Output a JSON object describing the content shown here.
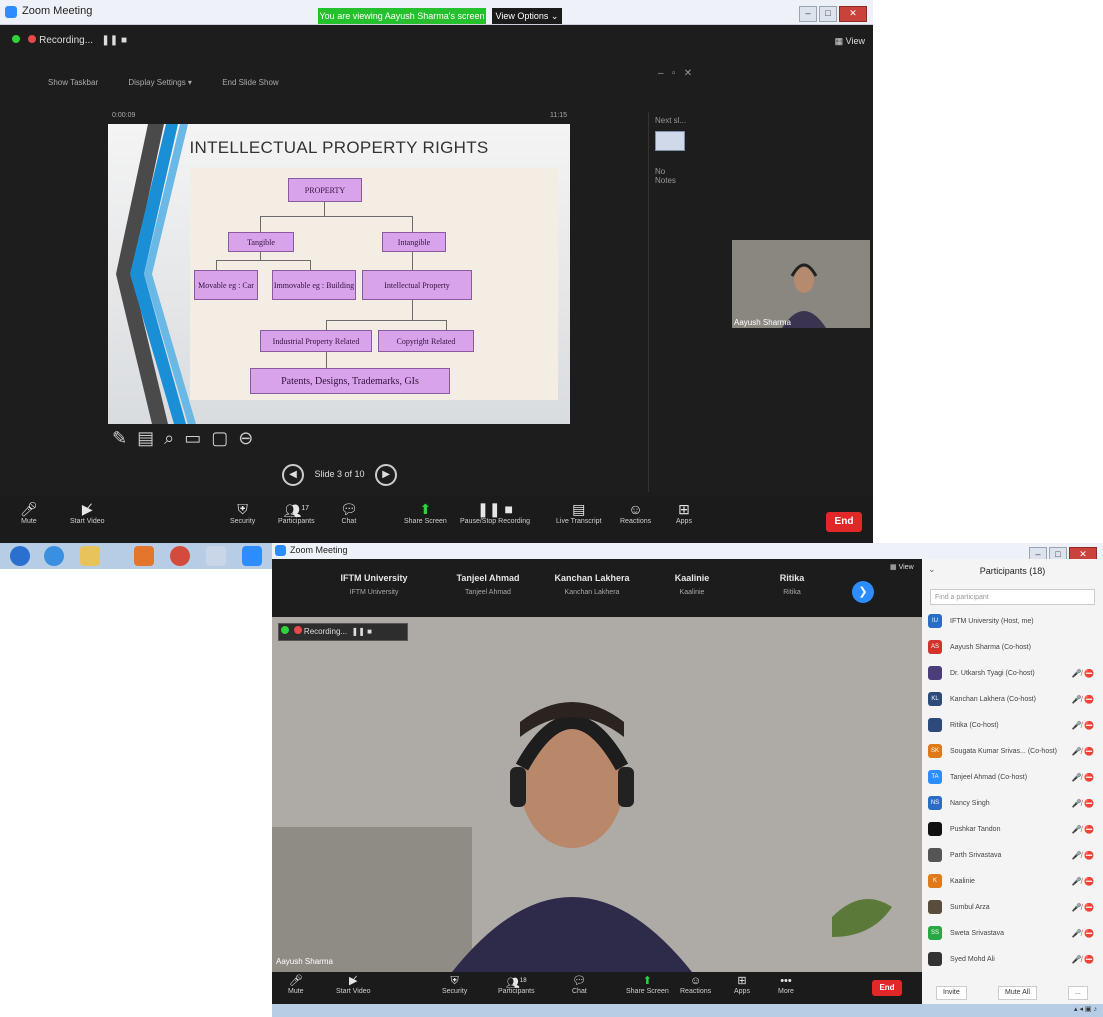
{
  "win1": {
    "title": "Zoom Meeting",
    "screen_share_banner": "You are viewing Aayush Sharma's screen",
    "view_options": "View Options ⌄",
    "view_btn": "View",
    "recording_label": "Recording...",
    "toolbar": [
      "Show Taskbar",
      "Display Settings ▾",
      "End Slide Show"
    ],
    "timer": "0:00:09",
    "clock": "11:15",
    "slide": {
      "title": "INTELLECTUAL PROPERTY RIGHTS",
      "boxes": {
        "property": "PROPERTY",
        "tangible": "Tangible",
        "intangible": "Intangible",
        "movable": "Movable eg : Car",
        "immovable": "Immovable eg : Building",
        "ip": "Intellectual Property",
        "industrial": "Industrial Property Related",
        "copyright": "Copyright Related",
        "patents": "Patents, Designs, Trademarks, GIs"
      }
    },
    "slide_counter": "Slide 3 of 10",
    "notes": {
      "next": "Next sl...",
      "no_notes": "No Notes"
    },
    "pip_name": "Aayush Sharma",
    "controls": {
      "mute": "Mute",
      "start_video": "Start Video",
      "security": "Security",
      "participants": "Participants",
      "participants_count": "17",
      "chat": "Chat",
      "share_screen": "Share Screen",
      "pause_recording": "Pause/Stop Recording",
      "live_transcript": "Live Transcript",
      "reactions": "Reactions",
      "apps": "Apps",
      "end": "End"
    }
  },
  "win2": {
    "title": "Zoom Meeting",
    "view_btn": "View",
    "thumbs": [
      {
        "name": "IFTM University",
        "sub": "IFTM University"
      },
      {
        "name": "Tanjeel Ahmad",
        "sub": "Tanjeel Ahmad"
      },
      {
        "name": "Kanchan Lakhera",
        "sub": "Kanchan Lakhera"
      },
      {
        "name": "Kaalinie",
        "sub": "Kaalinie"
      },
      {
        "name": "Ritika",
        "sub": "Ritika"
      }
    ],
    "recording_label": "Recording...",
    "video_name": "Aayush Sharma",
    "participants": {
      "header": "Participants (18)",
      "search_placeholder": "Find a participant",
      "rows": [
        {
          "initials": "IU",
          "color": "#2a6dc9",
          "name": "IFTM University (Host, me)",
          "status": ""
        },
        {
          "initials": "AS",
          "color": "#d0342c",
          "name": "Aayush Sharma (Co-host)",
          "status": ""
        },
        {
          "initials": "",
          "color": "#4a3d7a",
          "name": "Dr. Utkarsh Tyagi (Co-host)",
          "status": "🎤̸ ⛔"
        },
        {
          "initials": "KL",
          "color": "#2d4a7a",
          "name": "Kanchan Lakhera (Co-host)",
          "status": "🎤̸ ⛔"
        },
        {
          "initials": "",
          "color": "#2d4a7a",
          "name": "Ritika (Co-host)",
          "status": "🎤̸ ⛔"
        },
        {
          "initials": "SK",
          "color": "#e07a18",
          "name": "Sougata Kumar Srivas... (Co-host)",
          "status": "🎤̸ ⛔"
        },
        {
          "initials": "TA",
          "color": "#2d8cff",
          "name": "Tanjeel Ahmad (Co-host)",
          "status": "🎤̸ ⛔"
        },
        {
          "initials": "NS",
          "color": "#2a6dc9",
          "name": "Nancy Singh",
          "status": "🎤̸ ⛔"
        },
        {
          "initials": "",
          "color": "#111111",
          "name": "Pushkar Tandon",
          "status": "🎤̸ ⛔"
        },
        {
          "initials": "",
          "color": "#555555",
          "name": "Parth Srivastava",
          "status": "🎤̸ ⛔"
        },
        {
          "initials": "K",
          "color": "#e07a18",
          "name": "Kaalinie",
          "status": "🎤̸ ⛔"
        },
        {
          "initials": "",
          "color": "#5b4d3d",
          "name": "Sumbul Arza",
          "status": "🎤̸ ⛔"
        },
        {
          "initials": "SS",
          "color": "#27a844",
          "name": "Sweta Srivastava",
          "status": "🎤̸ ⛔"
        },
        {
          "initials": "",
          "color": "#333333",
          "name": "Syed Mohd Ali",
          "status": "🎤̸ ⛔"
        }
      ],
      "invite": "Invite",
      "mute_all": "Mute All",
      "more": "..."
    },
    "controls": {
      "mute": "Mute",
      "start_video": "Start Video",
      "security": "Security",
      "participants": "Participants",
      "participants_count": "18",
      "chat": "Chat",
      "share_screen": "Share Screen",
      "reactions": "Reactions",
      "apps": "Apps",
      "more": "More",
      "end": "End"
    }
  }
}
